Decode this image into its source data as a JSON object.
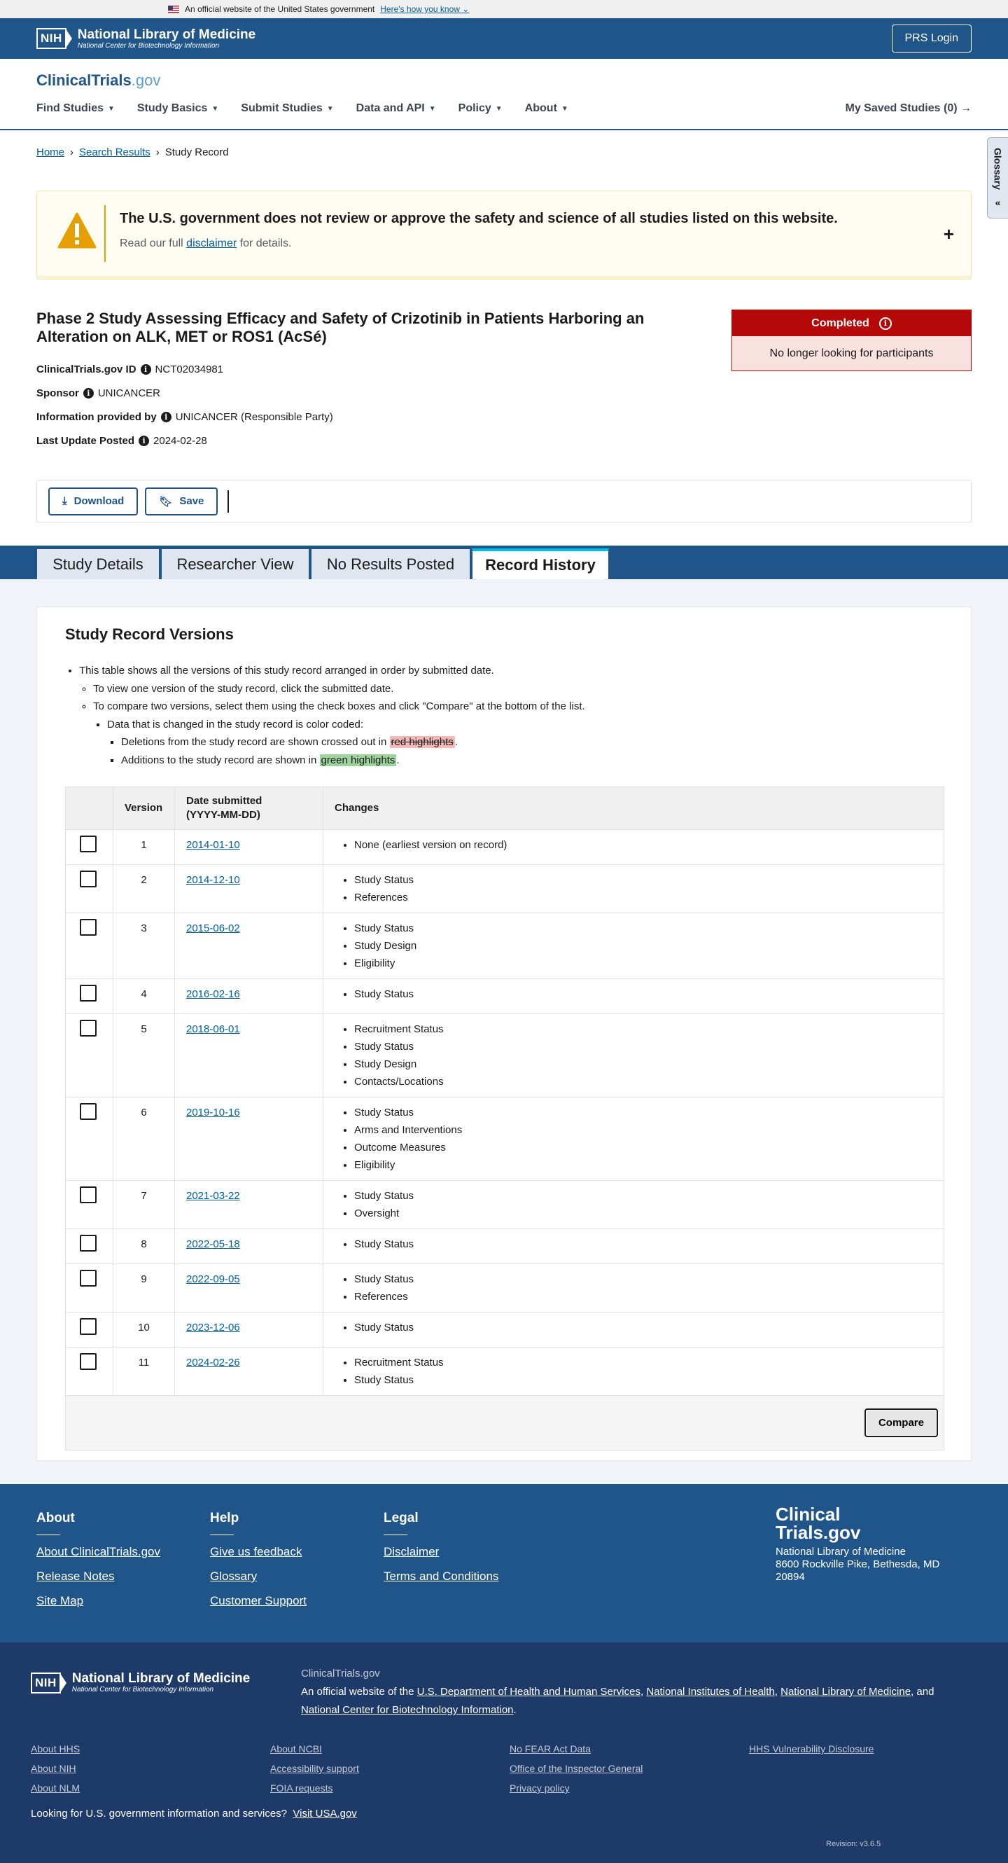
{
  "gov_banner": {
    "text": "An official website of the United States government",
    "link": "Here's how you know"
  },
  "nlm": {
    "nih": "NIH",
    "line1": "National Library of Medicine",
    "line2": "National Center for Biotechnology Information",
    "prs_login": "PRS Login"
  },
  "header": {
    "logo_main": "ClinicalTrials",
    "logo_suffix": ".gov",
    "nav": [
      "Find Studies",
      "Study Basics",
      "Submit Studies",
      "Data and API",
      "Policy",
      "About"
    ],
    "saved": "My Saved Studies (0)",
    "glossary": "Glossary"
  },
  "breadcrumb": {
    "home": "Home",
    "search": "Search Results",
    "current": "Study Record"
  },
  "disclaimer": {
    "title": "The U.S. government does not review or approve the safety and science of all studies listed on this website.",
    "pre": "Read our full",
    "link": "disclaimer",
    "post": "for details."
  },
  "study": {
    "title": "Phase 2 Study Assessing Efficacy and Safety of Crizotinib in Patients Harboring an Alteration on ALK, MET or ROS1 (AcSé)",
    "id_label": "ClinicalTrials.gov ID",
    "id_value": "NCT02034981",
    "sponsor_label": "Sponsor",
    "sponsor_value": "UNICANCER",
    "info_label": "Information provided by",
    "info_value": "UNICANCER (Responsible Party)",
    "update_label": "Last Update Posted",
    "update_value": "2024-02-28",
    "status": "Completed",
    "status_note": "No longer looking for participants"
  },
  "actions": {
    "download": "Download",
    "save": "Save"
  },
  "tabs": [
    "Study Details",
    "Researcher View",
    "No Results Posted",
    "Record History"
  ],
  "versions_section": {
    "title": "Study Record Versions",
    "intro": "This table shows all the versions of this study record arranged in order by submitted date.",
    "view": "To view one version of the study record, click the submitted date.",
    "compare": "To compare two versions, select them using the check boxes and click \"Compare\" at the bottom of the list.",
    "coded": "Data that is changed in the study record is color coded:",
    "del_pre": "Deletions from the study record are shown crossed out in",
    "del_hl": "red highlights",
    "del_post": ".",
    "add_pre": "Additions to the study record are shown in",
    "add_hl": "green highlights",
    "add_post": ".",
    "col_version": "Version",
    "col_date_1": "Date submitted",
    "col_date_2": "(YYYY-MM-DD)",
    "col_changes": "Changes",
    "rows": [
      {
        "v": "1",
        "date": "2014-01-10",
        "changes": [
          "None (earliest version on record)"
        ]
      },
      {
        "v": "2",
        "date": "2014-12-10",
        "changes": [
          "Study Status",
          "References"
        ]
      },
      {
        "v": "3",
        "date": "2015-06-02",
        "changes": [
          "Study Status",
          "Study Design",
          "Eligibility"
        ]
      },
      {
        "v": "4",
        "date": "2016-02-16",
        "changes": [
          "Study Status"
        ]
      },
      {
        "v": "5",
        "date": "2018-06-01",
        "changes": [
          "Recruitment Status",
          "Study Status",
          "Study Design",
          "Contacts/Locations"
        ]
      },
      {
        "v": "6",
        "date": "2019-10-16",
        "changes": [
          "Study Status",
          "Arms and Interventions",
          "Outcome Measures",
          "Eligibility"
        ]
      },
      {
        "v": "7",
        "date": "2021-03-22",
        "changes": [
          "Study Status",
          "Oversight"
        ]
      },
      {
        "v": "8",
        "date": "2022-05-18",
        "changes": [
          "Study Status"
        ]
      },
      {
        "v": "9",
        "date": "2022-09-05",
        "changes": [
          "Study Status",
          "References"
        ]
      },
      {
        "v": "10",
        "date": "2023-12-06",
        "changes": [
          "Study Status"
        ]
      },
      {
        "v": "11",
        "date": "2024-02-26",
        "changes": [
          "Recruitment Status",
          "Study Status"
        ]
      }
    ],
    "compare_btn": "Compare"
  },
  "footer": {
    "about_title": "About",
    "about_links": [
      "About ClinicalTrials.gov",
      "Release Notes",
      "Site Map"
    ],
    "help_title": "Help",
    "help_links": [
      "Give us feedback",
      "Glossary",
      "Customer Support"
    ],
    "legal_title": "Legal",
    "legal_links": [
      "Disclaimer",
      "Terms and Conditions"
    ],
    "brand_1": "Clinical",
    "brand_2": "Trials.gov",
    "addr_1": "National Library of Medicine",
    "addr_2": "8600 Rockville Pike, Bethesda, MD",
    "addr_3": "20894"
  },
  "footer_bottom": {
    "site": "ClinicalTrials.gov",
    "official": "An official website of the",
    "hhs": "U.S. Department of Health and Human Services",
    "nih": "National Institutes of Health",
    "nlm": "National Library of Medicine",
    "and": "and",
    "ncbi": "National Center for Biotechnology Information",
    "col1": [
      "About HHS",
      "About NIH",
      "About NLM"
    ],
    "col2": [
      "About NCBI",
      "Accessibility support",
      "FOIA requests"
    ],
    "col3": [
      "No FEAR Act Data",
      "Office of the Inspector General",
      "Privacy policy"
    ],
    "col4": [
      "HHS Vulnerability Disclosure"
    ],
    "usa_q": "Looking for U.S. government information and services?",
    "usa_link": "Visit USA.gov",
    "revision": "Revision: v3.6.5"
  },
  "colors": {
    "primary": "#20558a",
    "status_red": "#b50909",
    "warning": "#e5a000"
  }
}
